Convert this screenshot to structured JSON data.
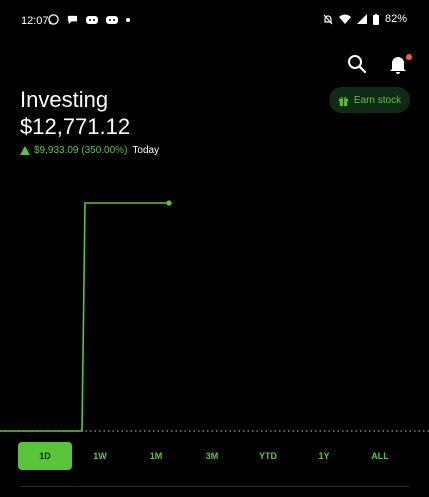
{
  "status": {
    "time": "12:07",
    "battery": "82%"
  },
  "portfolio": {
    "title": "Investing",
    "value": "$12,771.12",
    "change": "$9,933.09 (350.00%)",
    "period": "Today"
  },
  "actions": {
    "earn_label": "Earn stock"
  },
  "ranges": [
    "1D",
    "1W",
    "1M",
    "3M",
    "YTD",
    "1Y",
    "ALL"
  ],
  "active_range": "1D",
  "colors": {
    "accent": "#5ac53a",
    "background": "#000000",
    "notification": "#ff5a36"
  }
}
